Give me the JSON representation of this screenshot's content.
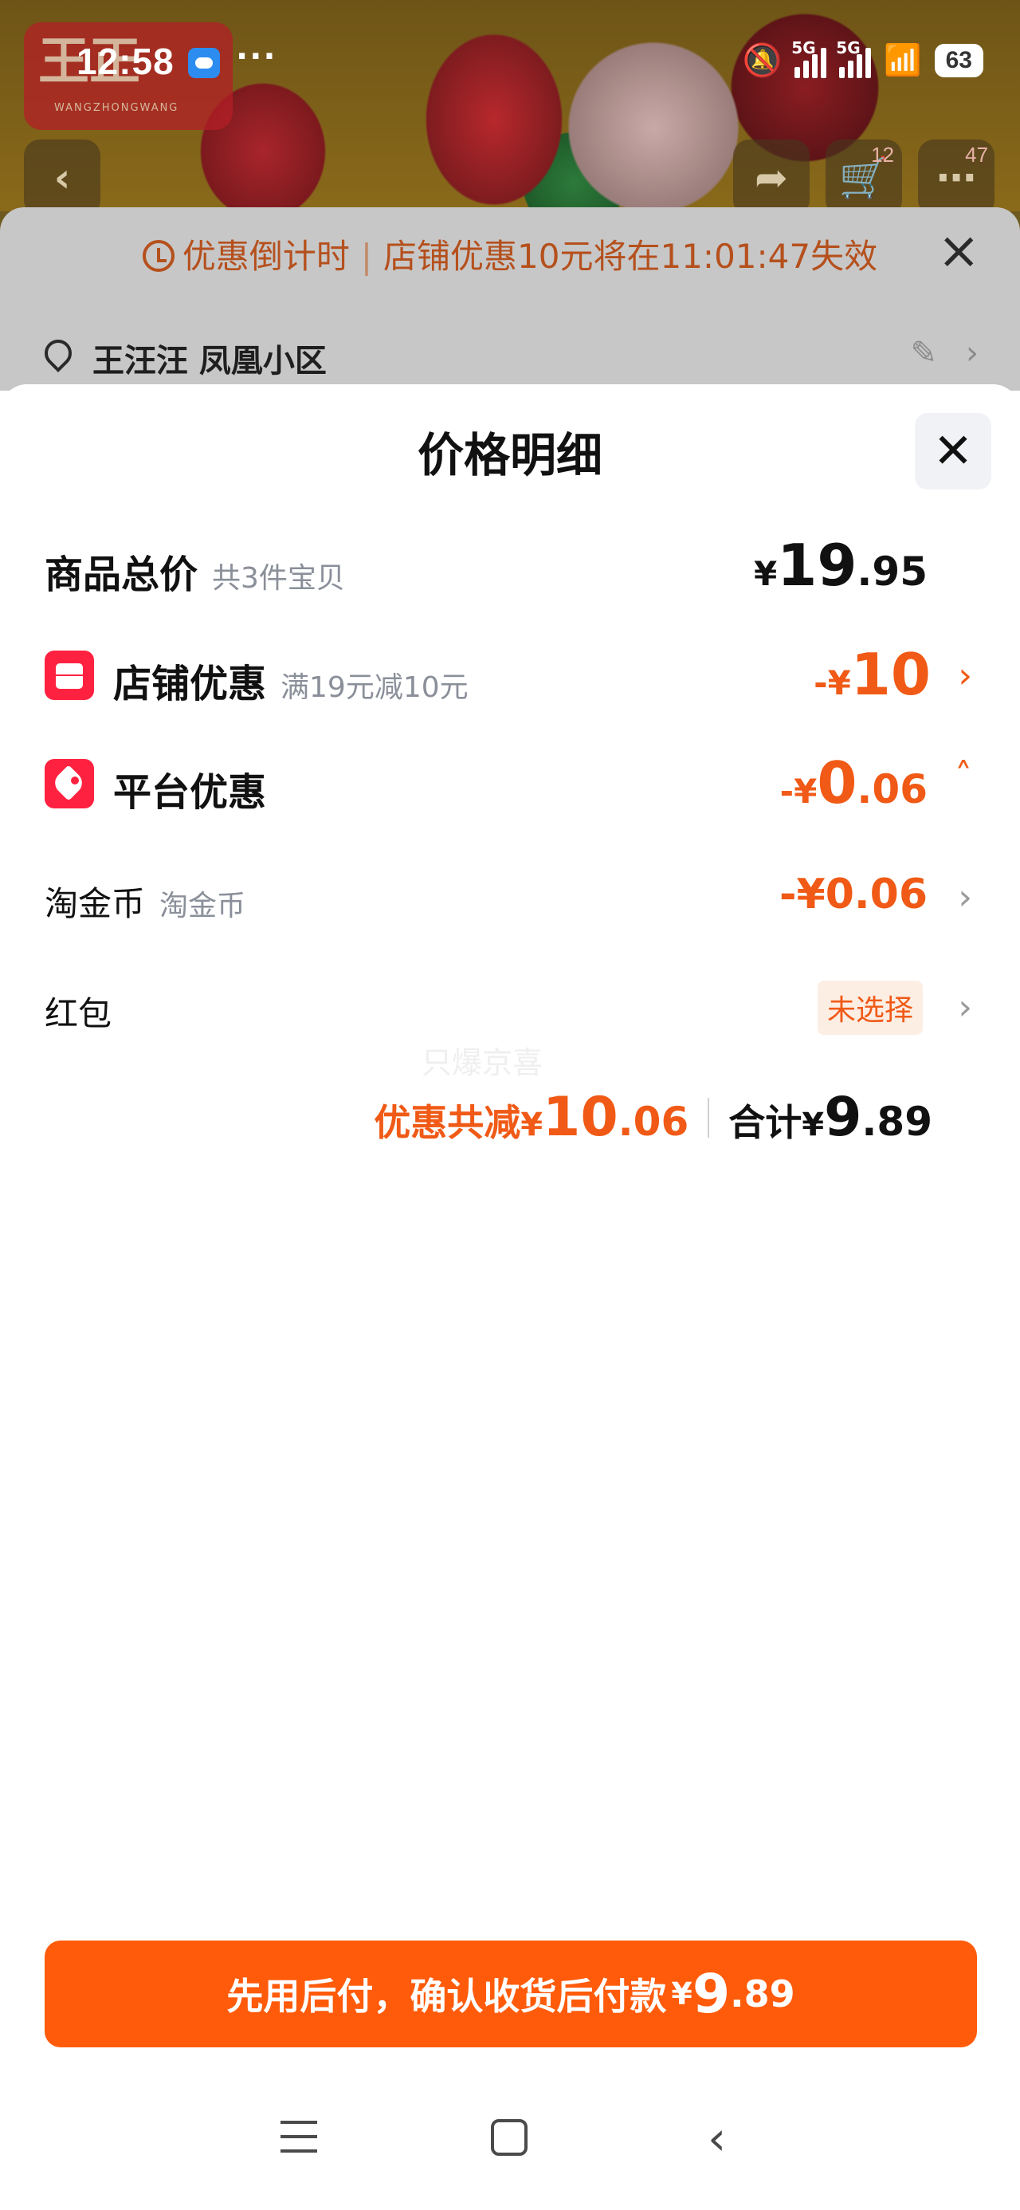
{
  "status_bar": {
    "time": "12:58",
    "more": "···",
    "network_1": "5G",
    "network_2": "5G",
    "battery": "63"
  },
  "nav": {
    "cart_badge": "12",
    "message_badge": "47"
  },
  "promo": {
    "countdown_label": "优惠倒计时",
    "separator": "|",
    "message": "店铺优惠10元将在11:01:47失效"
  },
  "address": {
    "text": "王汪汪 凤凰小区"
  },
  "sheet": {
    "title": "价格明细",
    "rows": [
      {
        "label": "商品总价",
        "sub": "共3件宝贝",
        "sym": "¥",
        "int": "19",
        "dec": ".95"
      },
      {
        "label": "店铺优惠",
        "sub": "满19元减10元",
        "sym": "-¥",
        "int": "10",
        "dec": ""
      },
      {
        "label": "平台优惠",
        "sub": "",
        "sym": "-¥",
        "int": "0",
        "dec": ".06"
      },
      {
        "label": "淘金币",
        "sub": "淘金币",
        "value": "-¥0.06"
      },
      {
        "label": "红包",
        "chip": "未选择"
      }
    ],
    "watermark": "只爆京喜",
    "summary": {
      "discount_label": "优惠共减",
      "discount_sym": "¥",
      "discount_int": "10",
      "discount_dec": ".06",
      "total_label": "合计",
      "total_sym": "¥",
      "total_int": "9",
      "total_dec": ".89"
    },
    "pay_button": {
      "text": "先用后付，确认收货后付款",
      "sym": "¥",
      "int": "9",
      "dec": ".89"
    }
  },
  "colors": {
    "accent": "#ff5b0b",
    "discount": "#f05a16",
    "icon_red": "#ff2240"
  },
  "icons": [
    "clock-icon",
    "close-icon",
    "location-pin-icon",
    "edit-icon",
    "shop-icon",
    "tag-icon",
    "chevron-right-icon",
    "chevron-up-icon",
    "menu-icon",
    "home-icon",
    "back-icon"
  ]
}
